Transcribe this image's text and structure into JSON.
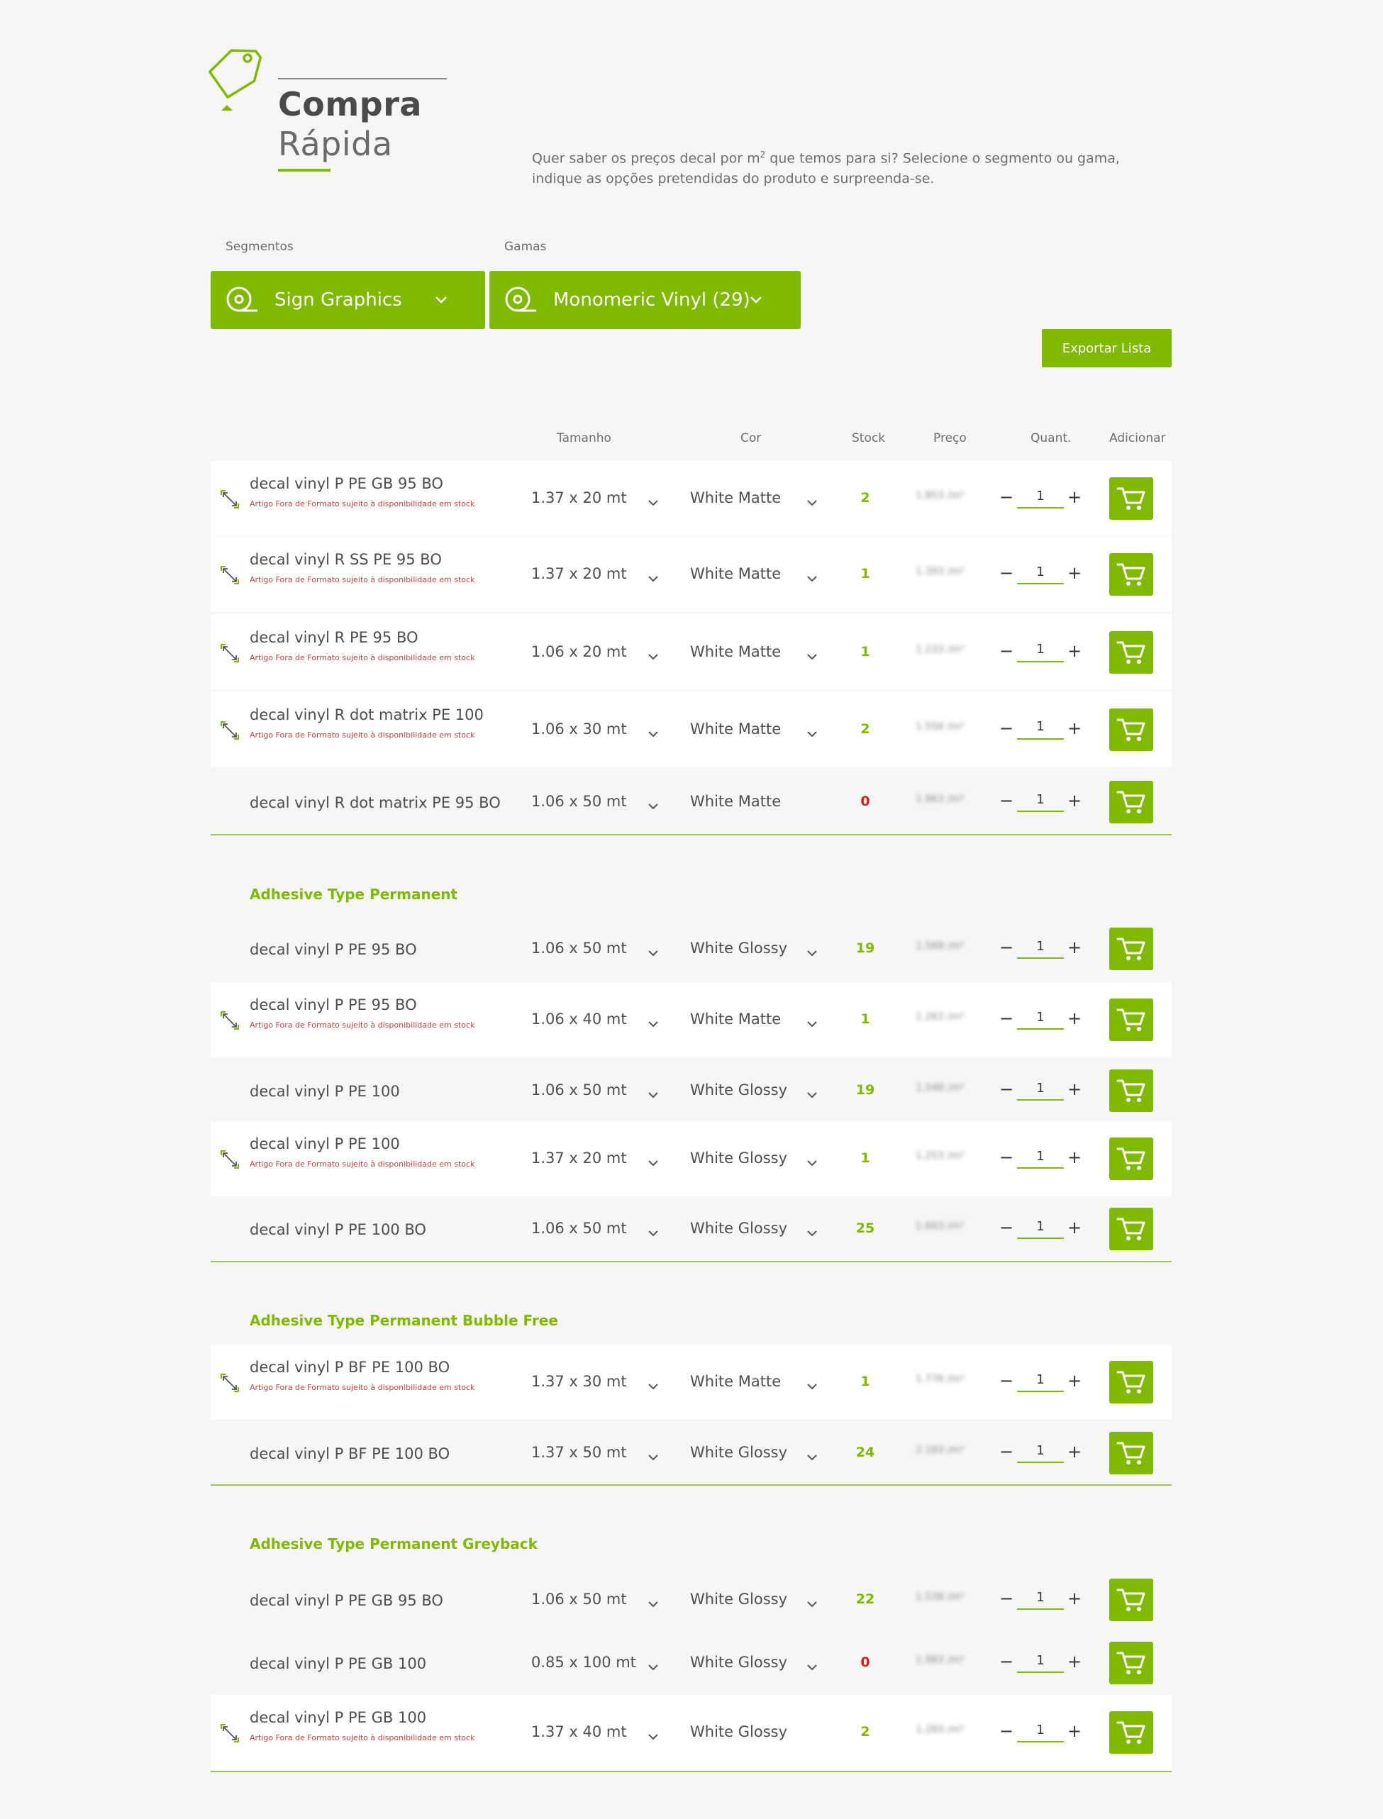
{
  "header": {
    "title_line1": "Compra",
    "title_line2": "Rápida",
    "intro_part1": "Quer saber os preços decal por m",
    "intro_sup": "2",
    "intro_part2": " que temos para si? Selecione o segmento ou gama,",
    "intro_line2": "indique as opções pretendidas do produto e surpreenda-se."
  },
  "filters": {
    "segments_label": "Segmentos",
    "segments_value": "Sign Graphics",
    "ranges_label": "Gamas",
    "ranges_value": "Monomeric Vinyl (29)",
    "export_label": "Exportar Lista"
  },
  "columns": {
    "size": "Tamanho",
    "color": "Cor",
    "stock": "Stock",
    "price": "Preço",
    "qty": "Quant.",
    "add": "Adicionar"
  },
  "colors": {
    "accent": "#7fba00",
    "out_of_stock": "#d42020",
    "warning": "#d04040"
  },
  "groups": [
    {
      "title": "",
      "rows": [
        {
          "name": "decal vinyl P PE GB 95 BO",
          "warn": "Artigo Fora de Formato sujeito à disponibilidade em stock",
          "size": "1.37 x 20 mt",
          "color": "White Matte",
          "stock": "2",
          "price": "1.853 /m²",
          "qty": "1"
        },
        {
          "name": "decal vinyl R SS PE 95 BO",
          "warn": "Artigo Fora de Formato sujeito à disponibilidade em stock",
          "size": "1.37 x 20 mt",
          "color": "White Matte",
          "stock": "1",
          "price": "1.393 /m²",
          "qty": "1"
        },
        {
          "name": "decal vinyl R PE 95 BO",
          "warn": "Artigo Fora de Formato sujeito à disponibilidade em stock",
          "size": "1.06 x 20 mt",
          "color": "White Matte",
          "stock": "1",
          "price": "1.233 /m²",
          "qty": "1"
        },
        {
          "name": "decal vinyl R dot matrix PE 100",
          "warn": "Artigo Fora de Formato sujeito à disponibilidade em stock",
          "size": "1.06 x 30 mt",
          "color": "White Matte",
          "stock": "2",
          "price": "1.556 /m²",
          "qty": "1"
        },
        {
          "name": "decal vinyl R dot matrix PE 95 BO",
          "warn": "",
          "size": "1.06 x 50 mt",
          "color": "White Matte",
          "stock": "0",
          "price": "1.963 /m²",
          "qty": "1"
        }
      ]
    },
    {
      "title": "Adhesive Type Permanent",
      "rows": [
        {
          "name": "decal vinyl P PE 95 BO",
          "warn": "",
          "size": "1.06 x 50 mt",
          "color": "White Glossy",
          "stock": "19",
          "price": "1.568 /m²",
          "qty": "1"
        },
        {
          "name": "decal vinyl P PE 95 BO",
          "warn": "Artigo Fora de Formato sujeito à disponibilidade em stock",
          "size": "1.06 x 40 mt",
          "color": "White Matte",
          "stock": "1",
          "price": "1.263 /m²",
          "qty": "1"
        },
        {
          "name": "decal vinyl P PE 100",
          "warn": "",
          "size": "1.06 x 50 mt",
          "color": "White Glossy",
          "stock": "19",
          "price": "1.548 /m²",
          "qty": "1"
        },
        {
          "name": "decal vinyl P PE 100",
          "warn": "Artigo Fora de Formato sujeito à disponibilidade em stock",
          "size": "1.37 x 20 mt",
          "color": "White Glossy",
          "stock": "1",
          "price": "1.253 /m²",
          "qty": "1"
        },
        {
          "name": "decal vinyl P PE 100 BO",
          "warn": "",
          "size": "1.06 x 50 mt",
          "color": "White Glossy",
          "stock": "25",
          "price": "1.663 /m²",
          "qty": "1"
        }
      ]
    },
    {
      "title": "Adhesive Type Permanent Bubble Free",
      "rows": [
        {
          "name": "decal vinyl P BF PE 100 BO",
          "warn": "Artigo Fora de Formato sujeito à disponibilidade em stock",
          "size": "1.37 x 30 mt",
          "color": "White Matte",
          "stock": "1",
          "price": "1.776 /m²",
          "qty": "1"
        },
        {
          "name": "decal vinyl P BF PE 100 BO",
          "warn": "",
          "size": "1.37 x 50 mt",
          "color": "White Glossy",
          "stock": "24",
          "price": "2.183 /m²",
          "qty": "1"
        }
      ]
    },
    {
      "title": "Adhesive Type Permanent Greyback",
      "rows": [
        {
          "name": "decal vinyl P PE GB 95 BO",
          "warn": "",
          "size": "1.06 x 50 mt",
          "color": "White Glossy",
          "stock": "22",
          "price": "1.538 /m²",
          "qty": "1"
        },
        {
          "name": "decal vinyl P PE GB 100",
          "warn": "",
          "size": "0.85 x 100 mt",
          "color": "White Glossy",
          "stock": "0",
          "price": "1.983 /m²",
          "qty": "1"
        },
        {
          "name": "decal vinyl P PE GB 100",
          "warn": "Artigo Fora de Formato sujeito à disponibilidade em stock",
          "size": "1.37 x 40 mt",
          "color": "White Glossy",
          "stock": "2",
          "price": "1.283 /m²",
          "qty": "1"
        }
      ]
    }
  ]
}
